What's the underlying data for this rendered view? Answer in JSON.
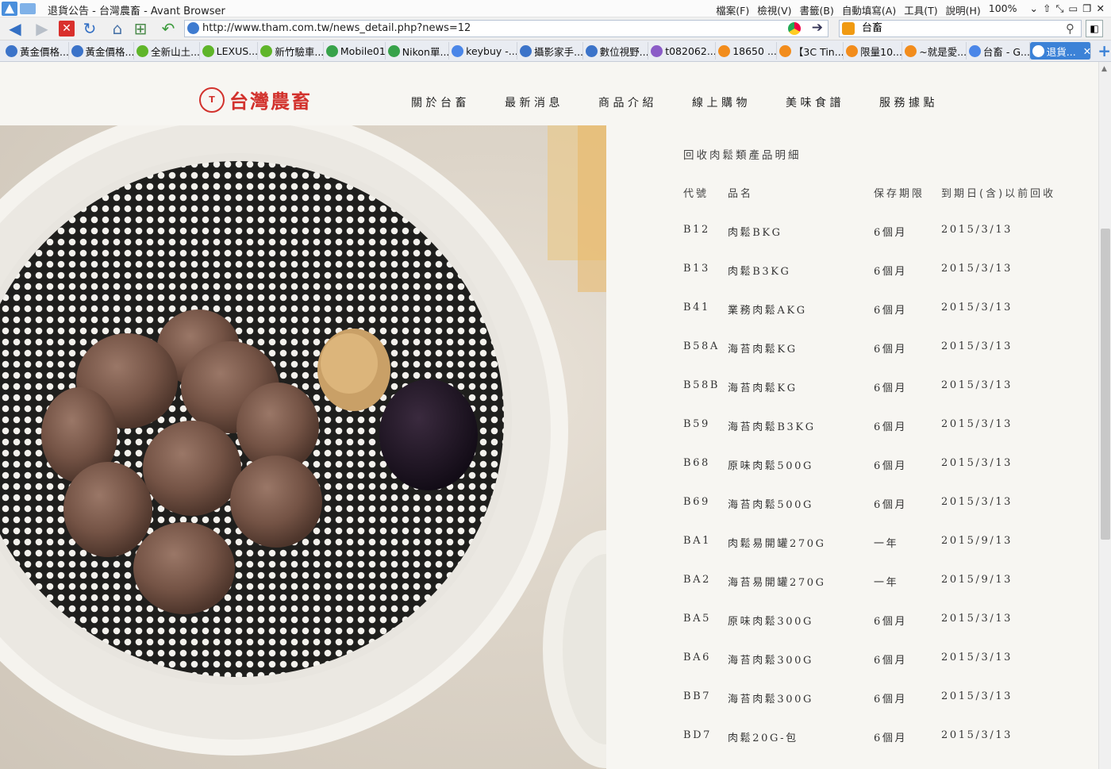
{
  "browser": {
    "window_title": "退貨公告 - 台灣農畜 - Avant Browser",
    "menus": [
      "檔案(F)",
      "檢視(V)",
      "書籤(B)",
      "自動填寫(A)",
      "工具(T)",
      "說明(H)",
      "100%"
    ],
    "url": "http://www.tham.com.tw/news_detail.php?news=12",
    "search_value": "台畜",
    "tabs": [
      {
        "label": "黃金價格...",
        "color": "#3b73c9"
      },
      {
        "label": "黃金價格...",
        "color": "#3b73c9"
      },
      {
        "label": "全新山土...",
        "color": "#5fb52a"
      },
      {
        "label": "LEXUS...",
        "color": "#5fb52a"
      },
      {
        "label": "新竹驗車...",
        "color": "#5fb52a"
      },
      {
        "label": "Mobile01",
        "color": "#37a24a"
      },
      {
        "label": "Nikon單...",
        "color": "#37a24a"
      },
      {
        "label": "keybuy -...",
        "color": "#4a86e8"
      },
      {
        "label": "攝影家手...",
        "color": "#3b73c9"
      },
      {
        "label": "數位視野...",
        "color": "#3b73c9"
      },
      {
        "label": "t082062...",
        "color": "#8b5cc7"
      },
      {
        "label": "18650 ...",
        "color": "#f28c1c"
      },
      {
        "label": "【3C Tin...",
        "color": "#f28c1c"
      },
      {
        "label": "限量10...",
        "color": "#f28c1c"
      },
      {
        "label": "~就是愛...",
        "color": "#f28c1c"
      },
      {
        "label": "台畜 - G...",
        "color": "#4a86e8"
      }
    ],
    "active_tab": {
      "label": "退貨..."
    }
  },
  "site": {
    "logo_text": "台灣農畜",
    "nav": [
      "關於台畜",
      "最新消息",
      "商品介紹",
      "線上購物",
      "美味食譜",
      "服務據點"
    ]
  },
  "recall": {
    "title": "回收肉鬆類產品明細",
    "headers": {
      "code": "代號",
      "name": "品名",
      "shelf": "保存期限",
      "expiry": "到期日(含)以前回收"
    },
    "rows": [
      {
        "code": "B12",
        "name": "肉鬆BKG",
        "shelf": "6個月",
        "expiry": "2015/3/13"
      },
      {
        "code": "B13",
        "name": "肉鬆B3KG",
        "shelf": "6個月",
        "expiry": "2015/3/13"
      },
      {
        "code": "B41",
        "name": "業務肉鬆AKG",
        "shelf": "6個月",
        "expiry": "2015/3/13"
      },
      {
        "code": "B58A",
        "name": "海苔肉鬆KG",
        "shelf": "6個月",
        "expiry": "2015/3/13"
      },
      {
        "code": "B58B",
        "name": "海苔肉鬆KG",
        "shelf": "6個月",
        "expiry": "2015/3/13"
      },
      {
        "code": "B59",
        "name": "海苔肉鬆B3KG",
        "shelf": "6個月",
        "expiry": "2015/3/13"
      },
      {
        "code": "B68",
        "name": "原味肉鬆500G",
        "shelf": "6個月",
        "expiry": "2015/3/13"
      },
      {
        "code": "B69",
        "name": "海苔肉鬆500G",
        "shelf": "6個月",
        "expiry": "2015/3/13"
      },
      {
        "code": "BA1",
        "name": "肉鬆易開罐270G",
        "shelf": "一年",
        "expiry": "2015/9/13"
      },
      {
        "code": "BA2",
        "name": "海苔易開罐270G",
        "shelf": "一年",
        "expiry": "2015/9/13"
      },
      {
        "code": "BA5",
        "name": "原味肉鬆300G",
        "shelf": "6個月",
        "expiry": "2015/3/13"
      },
      {
        "code": "BA6",
        "name": "海苔肉鬆300G",
        "shelf": "6個月",
        "expiry": "2015/3/13"
      },
      {
        "code": "BB7",
        "name": "海苔肉鬆300G",
        "shelf": "6個月",
        "expiry": "2015/3/13"
      },
      {
        "code": "BD7",
        "name": "肉鬆20G-包",
        "shelf": "6個月",
        "expiry": "2015/3/13"
      }
    ]
  }
}
